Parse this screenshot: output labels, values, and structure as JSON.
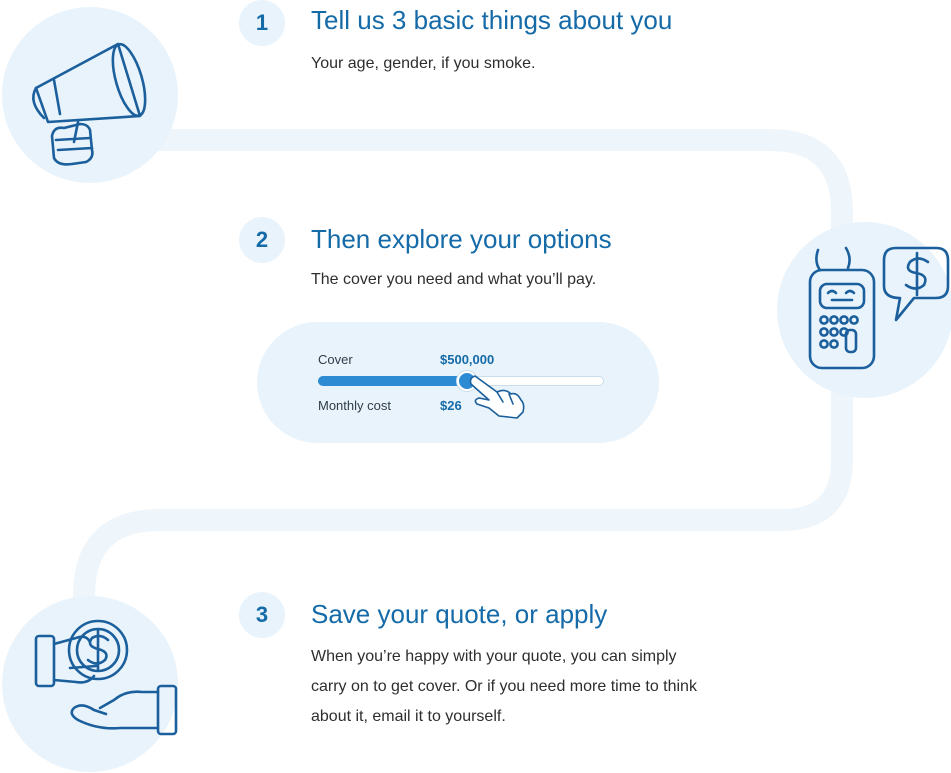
{
  "steps": [
    {
      "number": "1",
      "title": "Tell us 3 basic things about you",
      "description": "Your age, gender, if you smoke.",
      "icon": "megaphone-icon"
    },
    {
      "number": "2",
      "title": "Then explore your options",
      "description": "The cover you need and what you’ll pay.",
      "icon": "calculator-icon"
    },
    {
      "number": "3",
      "title": "Save your quote, or apply",
      "description": "When you’re happy with your quote, you can simply carry on to get cover. Or if you need more time to think about it, email it to yourself.",
      "icon": "money-hands-icon"
    }
  ],
  "slider": {
    "cover_label": "Cover",
    "cover_value": "$500,000",
    "cost_label": "Monthly cost",
    "cost_value": "$26",
    "fill_fraction": 0.52
  },
  "colors": {
    "accent": "#156aa8",
    "slider_fill": "#2c8bd3",
    "light_bg": "#e8f3fb"
  }
}
